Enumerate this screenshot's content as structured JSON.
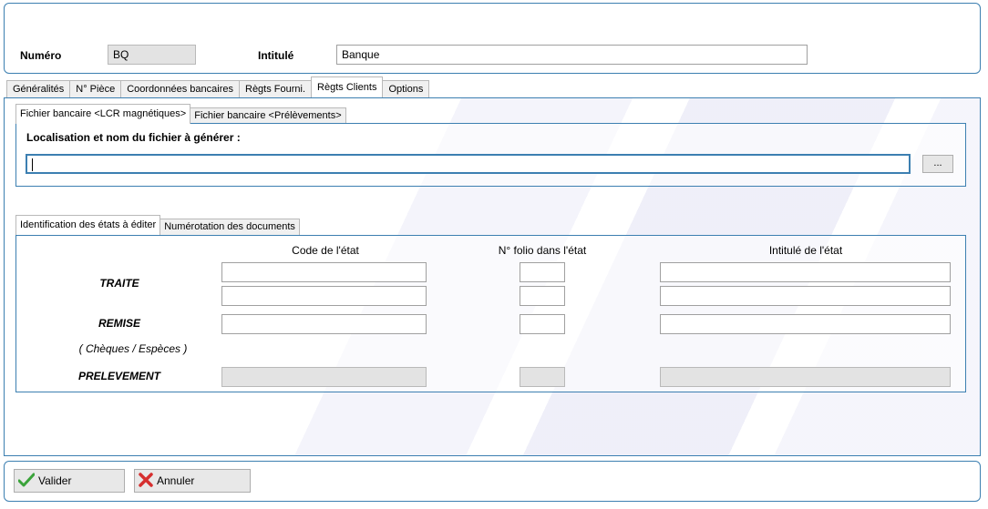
{
  "header": {
    "numero_label": "Numéro",
    "numero_value": "BQ",
    "intitule_label": "Intitulé",
    "intitule_value": "Banque"
  },
  "tabs": [
    {
      "label": "Généralités",
      "active": false
    },
    {
      "label": "N° Pièce",
      "active": false
    },
    {
      "label": "Coordonnées bancaires",
      "active": false
    },
    {
      "label": "Règts Fourni.",
      "active": false
    },
    {
      "label": "Règts Clients",
      "active": true
    },
    {
      "label": "Options",
      "active": false
    }
  ],
  "file_section": {
    "tabs": [
      {
        "label": "Fichier bancaire <LCR magnétiques>",
        "active": true
      },
      {
        "label": "Fichier bancaire <Prélèvements>",
        "active": false
      }
    ],
    "location_label": "Localisation et nom du fichier à générer :",
    "path_value": "",
    "browse_label": "..."
  },
  "states_section": {
    "tabs": [
      {
        "label": "Identification des états à éditer",
        "active": true
      },
      {
        "label": "Numérotation des documents",
        "active": false
      }
    ],
    "columns": {
      "code": "Code de l'état",
      "folio": "N° folio dans l'état",
      "intitule": "Intitulé de l'état"
    },
    "rows": {
      "traite": "TRAITE",
      "remise": "REMISE",
      "remise_note": "( Chèques / Espèces )",
      "prelevement": "PRELEVEMENT"
    }
  },
  "footer": {
    "validate_label": "Valider",
    "cancel_label": "Annuler"
  },
  "colors": {
    "accent": "#3c7fb1",
    "validate_icon": "#3aa33a",
    "cancel_icon": "#d62f2f"
  }
}
